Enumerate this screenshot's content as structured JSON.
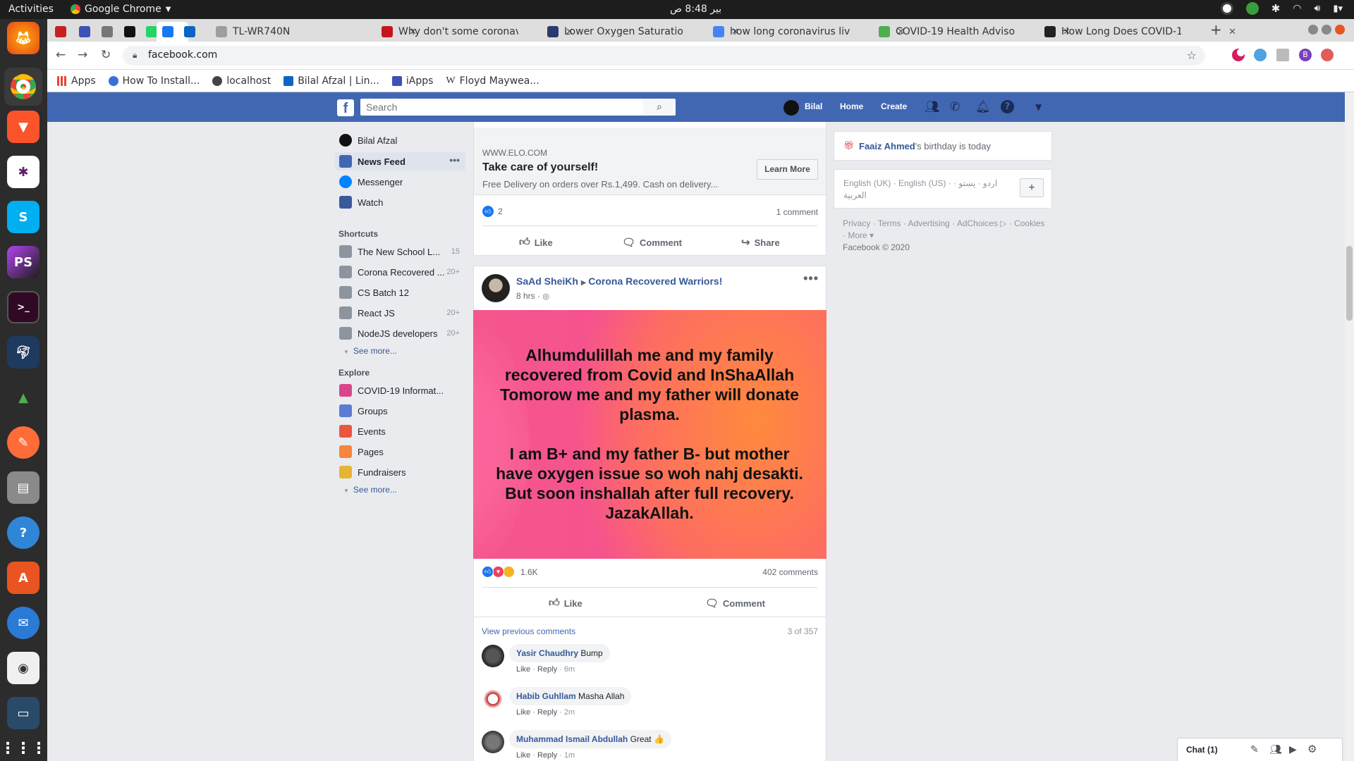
{
  "system": {
    "activities": "Activities",
    "app_name": "Google Chrome",
    "clock": "بير 8:48 ص"
  },
  "tabs": [
    {
      "title": "",
      "color": "#c5221f",
      "active": false
    },
    {
      "title": "",
      "color": "#3f51b5",
      "active": false
    },
    {
      "title": "",
      "color": "#777777",
      "active": false
    },
    {
      "title": "",
      "color": "#111111",
      "active": false
    },
    {
      "title": "",
      "color": "#25d366",
      "active": false
    },
    {
      "title": "",
      "color": "#1877f2",
      "active": true
    },
    {
      "title": "",
      "color": "#0a66c2",
      "active": false
    },
    {
      "title": "TL-WR740N",
      "color": "#9e9e9e",
      "active": false
    },
    {
      "title": "Why don't some coronav",
      "color": "#c4161c",
      "active": false
    },
    {
      "title": "Lower Oxygen Saturatio",
      "color": "#2d3a6e",
      "active": false
    },
    {
      "title": "how long coronavirus liv",
      "color": "#4285f4",
      "active": false
    },
    {
      "title": "COVID-19 Health Adviso",
      "color": "#4caf50",
      "active": false
    },
    {
      "title": "How Long Does COVID-1",
      "color": "#222222",
      "active": false
    }
  ],
  "browser": {
    "url": "facebook.com",
    "bookmarks": [
      "Apps",
      "How To Install...",
      "localhost",
      "Bilal Afzal | Lin...",
      "iApps",
      "Floyd Maywea..."
    ],
    "profile_letter": "B"
  },
  "header": {
    "search_placeholder": "Search",
    "user": "Bilal",
    "home": "Home",
    "create": "Create"
  },
  "leftnav": {
    "profile": "Bilal Afzal",
    "main": [
      {
        "label": "News Feed",
        "icon": "news-feed-icon",
        "color": "#4267b2"
      },
      {
        "label": "Messenger",
        "icon": "messenger-icon",
        "color": "#0084ff"
      },
      {
        "label": "Watch",
        "icon": "watch-icon",
        "color": "#3b5998"
      }
    ],
    "shortcuts_title": "Shortcuts",
    "shortcuts": [
      {
        "label": "The New School L...",
        "count": "15"
      },
      {
        "label": "Corona Recovered ...",
        "count": "20+"
      },
      {
        "label": "CS Batch 12",
        "count": ""
      },
      {
        "label": "React JS",
        "count": "20+"
      },
      {
        "label": "NodeJS developers",
        "count": "20+"
      }
    ],
    "see_more": "See more...",
    "explore_title": "Explore",
    "explore": [
      {
        "label": "COVID-19 Informat...",
        "color": "#d9458a"
      },
      {
        "label": "Groups",
        "color": "#5b7bd5"
      },
      {
        "label": "Events",
        "color": "#e9573f"
      },
      {
        "label": "Pages",
        "color": "#f5853f"
      },
      {
        "label": "Fundraisers",
        "color": "#e8b436"
      }
    ]
  },
  "ad_post": {
    "domain": "WWW.ELO.COM",
    "headline": "Take care of yourself!",
    "description": "Free Delivery on orders over Rs.1,499. Cash on delivery...",
    "cta": "Learn More",
    "reaction_count": "2",
    "comment_count": "1 comment",
    "like": "Like",
    "comment": "Comment",
    "share": "Share"
  },
  "post": {
    "author": "SaAd SheiKh",
    "group": "Corona Recovered Warriors!",
    "time": "8 hrs · ",
    "text": "Alhumdulillah me and my family recovered from Covid and InShaAllah Tomorow me and my father will donate plasma.",
    "text2": "I am B+ and my father B- but mother have oxygen issue so woh nahj desakti. But soon inshallah after full recovery. JazakAllah.",
    "reaction_count": "1.6K",
    "comment_count": "402 comments",
    "like": "Like",
    "comment": "Comment",
    "view_previous": "View previous comments",
    "comment_range": "3 of 357",
    "comments": [
      {
        "name": "Yasir Chaudhry",
        "text": "Bump",
        "like": "Like",
        "reply": "Reply",
        "time": "6m"
      },
      {
        "name": "Habib Guhllam",
        "text": "Masha Allah",
        "like": "Like",
        "reply": "Reply",
        "time": "2m"
      },
      {
        "name": "Muhammad Ismail Abdullah",
        "text": "Great 👍",
        "like": "Like",
        "reply": "Reply",
        "time": "1m"
      }
    ]
  },
  "right": {
    "birthday_name": "Faaiz Ahmed",
    "birthday_text": "'s birthday is today",
    "languages": "English (UK) · English (US) · اردو · پښتو · العربية",
    "lang_add": "+",
    "footer_links": "Privacy · Terms · Advertising · AdChoices ▷ · Cookies · More ▾",
    "copyright": "Facebook © 2020"
  },
  "chat": {
    "label": "Chat (1)"
  },
  "colors": {
    "fb_blue": "#4267b2",
    "link": "#365899",
    "post_bg_pink": "#f7578c",
    "post_bg_orange": "#ff8a3d"
  }
}
